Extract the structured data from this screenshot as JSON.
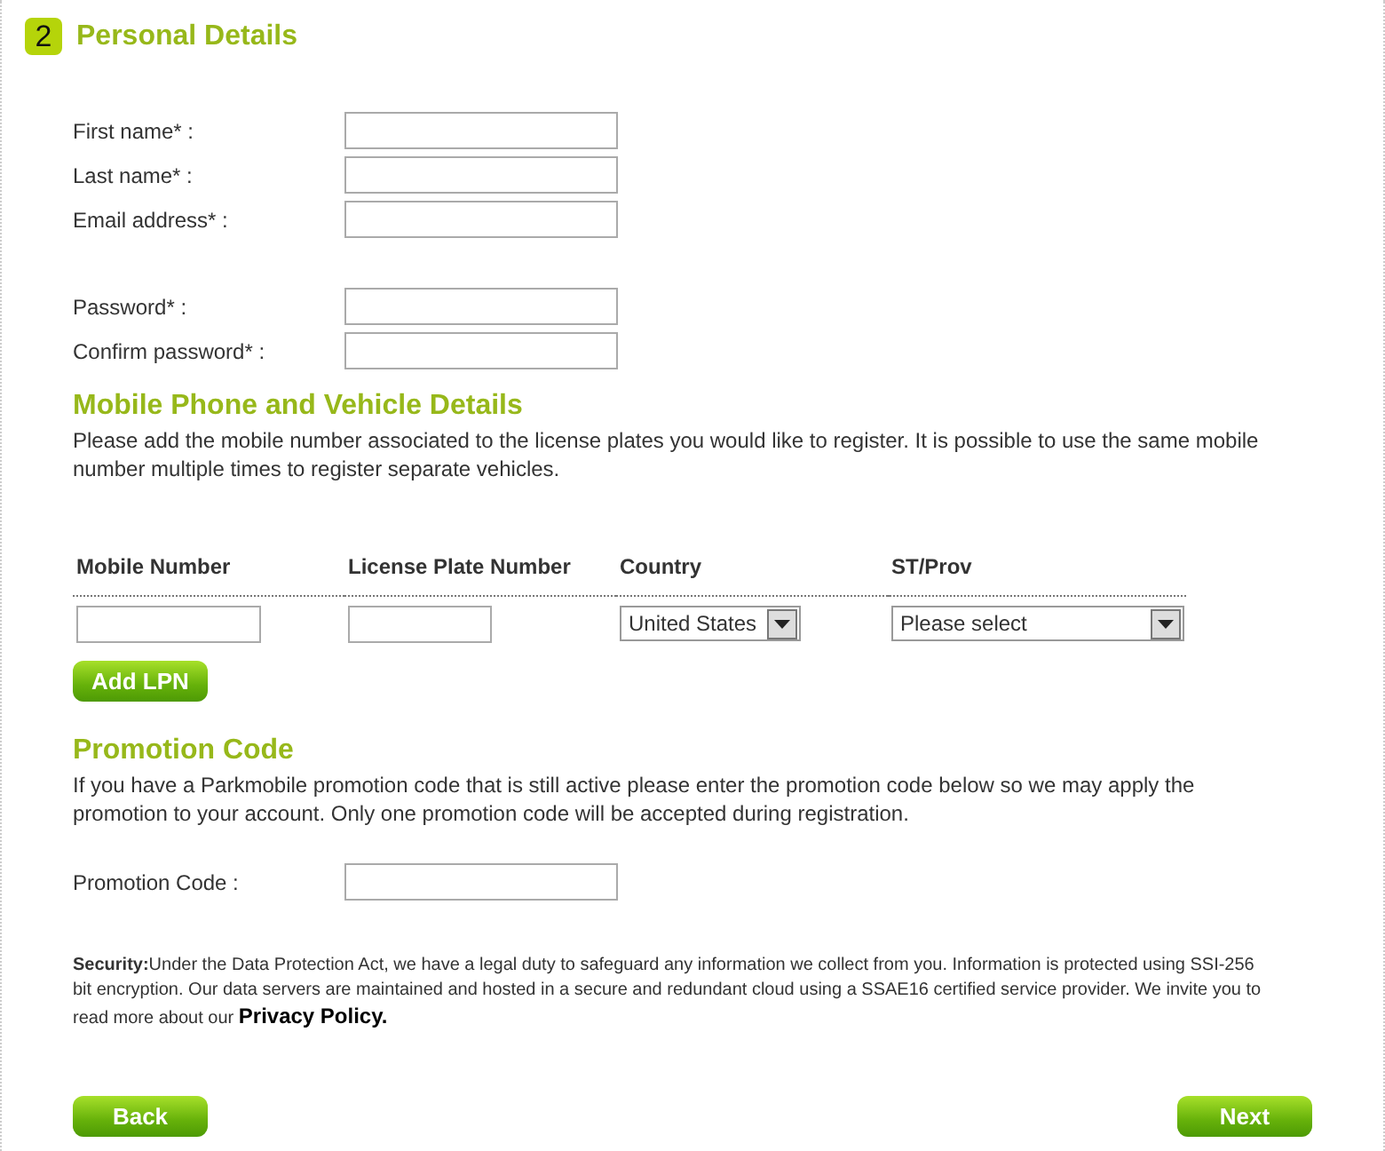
{
  "step": {
    "number": "2",
    "title": "Personal Details"
  },
  "personal_field_groups": [
    [
      {
        "label": "First name* :"
      },
      {
        "label": "Last name* :"
      },
      {
        "label": "Email address* :"
      }
    ],
    [
      {
        "label": "Password* :"
      },
      {
        "label": "Confirm password* :"
      }
    ]
  ],
  "mobile_section": {
    "title": "Mobile Phone and Vehicle Details",
    "description": "Please add the mobile number associated to the license plates you would like to register. It is possible to use the same mobile number multiple times to register separate vehicles.",
    "columns": [
      "Mobile Number",
      "License Plate Number",
      "Country",
      "ST/Prov"
    ],
    "row": {
      "country": "United States",
      "state": "Please select"
    },
    "add_button": "Add LPN"
  },
  "promotion_section": {
    "title": "Promotion Code",
    "description": "If you have a Parkmobile promotion code that is still active please enter the promotion code below so we may apply the promotion to your account. Only one promotion code will be accepted during registration.",
    "field_label": "Promotion Code :"
  },
  "security": {
    "text": "**Security:**Under the Data Protection Act, we have a legal duty to safeguard any information we collect from you. Information is protected using SSI-256 bit encryption. Our data servers are maintained and hosted in a secure and redundant cloud using a SSAE16 certified service provider. We invite you to read more about our ",
    "link": "Privacy Policy."
  },
  "buttons": {
    "back": "Back",
    "next": "Next"
  }
}
